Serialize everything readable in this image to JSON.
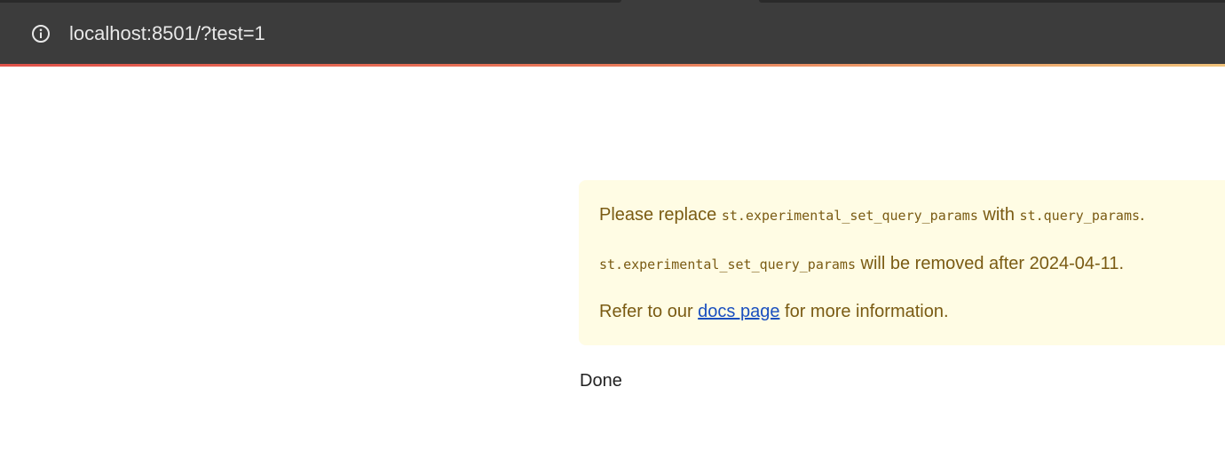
{
  "browser": {
    "url": "localhost:8501/?test=1",
    "info_icon": "info-circle-icon"
  },
  "warning": {
    "line1_prefix": "Please replace ",
    "line1_code1": "st.experimental_set_query_params",
    "line1_mid": " with ",
    "line1_code2": "st.query_params",
    "line1_suffix": ".",
    "line2_code": "st.experimental_set_query_params",
    "line2_suffix": " will be removed after 2024-04-11.",
    "line3_prefix": "Refer to our ",
    "line3_link": "docs page",
    "line3_suffix": " for more information.",
    "background_color": "#fffce4",
    "text_color": "#7a5b13",
    "link_color": "#1a4fbf"
  },
  "main": {
    "done_text": "Done"
  }
}
